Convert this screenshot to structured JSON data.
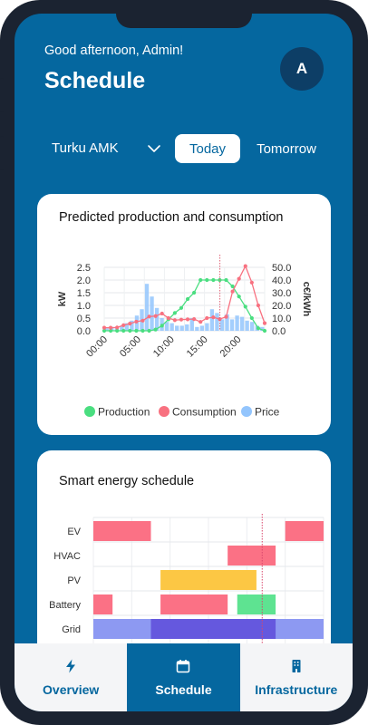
{
  "header": {
    "greeting": "Good afternoon, Admin!",
    "title": "Schedule",
    "avatar_initial": "A"
  },
  "selector": {
    "location": "Turku AMK",
    "tabs": [
      {
        "label": "Today",
        "active": true
      },
      {
        "label": "Tomorrow",
        "active": false
      }
    ]
  },
  "chart_card": {
    "title": "Predicted production and consumption",
    "chart_data": {
      "type": "line",
      "x_ticks": [
        "00:00",
        "05:00",
        "10:00",
        "15:00",
        "20:00"
      ],
      "y_left": {
        "label": "kW",
        "ticks": [
          "0.0",
          "0.5",
          "1.0",
          "1.5",
          "2.0",
          "2.5"
        ],
        "range": [
          0,
          2.5
        ]
      },
      "y_right": {
        "label": "c€/kWh",
        "ticks": [
          "0.0",
          "10.0",
          "20.0",
          "30.0",
          "40.0",
          "50.0"
        ],
        "range": [
          0,
          50
        ]
      },
      "hours": [
        0,
        1,
        2,
        3,
        4,
        5,
        6,
        7,
        8,
        9,
        10,
        11,
        12,
        13,
        14,
        15,
        16,
        17,
        18,
        19,
        20,
        21,
        22,
        23
      ],
      "series": [
        {
          "name": "Production",
          "color": "#4ade80",
          "axis": "left",
          "values": [
            0,
            0,
            0,
            0,
            0,
            0,
            0,
            0,
            0.05,
            0.2,
            0.45,
            0.7,
            0.9,
            1.25,
            1.5,
            2.0,
            2.0,
            2.0,
            2.0,
            2.0,
            1.75,
            1.35,
            0.95,
            0.5,
            0.1,
            0.0
          ]
        },
        {
          "name": "Consumption",
          "color": "#f87180",
          "axis": "left",
          "values": [
            0.12,
            0.12,
            0.13,
            0.22,
            0.28,
            0.36,
            0.4,
            0.56,
            0.58,
            0.68,
            0.5,
            0.42,
            0.44,
            0.45,
            0.46,
            0.35,
            0.5,
            0.53,
            0.46,
            0.55,
            1.55,
            2.05,
            2.55,
            1.9,
            1.0,
            0.3
          ]
        },
        {
          "name": "Price",
          "color": "#93c5fd",
          "axis": "right",
          "values": [
            2,
            3,
            2,
            4,
            6,
            8,
            12,
            17,
            37,
            27,
            18,
            10,
            7,
            6,
            4,
            4,
            5,
            10,
            3,
            4,
            6,
            17,
            14,
            9,
            13,
            9,
            12,
            11,
            8,
            7,
            4,
            3
          ]
        }
      ],
      "now_marker": 17.3,
      "legend": "bottom"
    }
  },
  "schedule_card": {
    "title": "Smart energy schedule",
    "rows": [
      {
        "label": "EV",
        "bars": [
          {
            "start": 0,
            "end": 6,
            "color": "#fb7185"
          },
          {
            "start": 20,
            "end": 24,
            "color": "#fb7185"
          }
        ]
      },
      {
        "label": "HVAC",
        "bars": [
          {
            "start": 14,
            "end": 19,
            "color": "#fb7185"
          }
        ]
      },
      {
        "label": "PV",
        "bars": [
          {
            "start": 7,
            "end": 17,
            "color": "#fcc744"
          }
        ]
      },
      {
        "label": "Battery",
        "bars": [
          {
            "start": 0,
            "end": 2,
            "color": "#fb7185"
          },
          {
            "start": 7,
            "end": 14,
            "color": "#fb7185"
          },
          {
            "start": 15,
            "end": 19,
            "color": "#5ee391"
          }
        ]
      },
      {
        "label": "Grid",
        "bars": [
          {
            "start": 0,
            "end": 24,
            "color": "#8d99f2"
          },
          {
            "start": 6,
            "end": 19,
            "color": "#6558de"
          }
        ]
      }
    ],
    "now_marker": 17.6
  },
  "bottom_nav": {
    "items": [
      {
        "label": "Overview",
        "icon": "bolt-icon",
        "active": false
      },
      {
        "label": "Schedule",
        "icon": "calendar-icon",
        "active": true
      },
      {
        "label": "Infrastructure",
        "icon": "building-icon",
        "active": false
      }
    ]
  }
}
